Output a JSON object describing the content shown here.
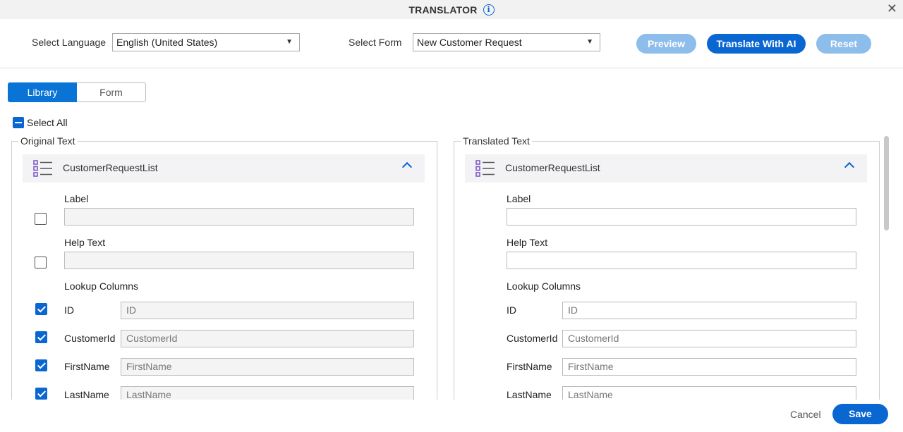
{
  "window": {
    "title": "TRANSLATOR"
  },
  "toolbar": {
    "language_label": "Select Language",
    "language_value": "English (United States)",
    "form_label": "Select Form",
    "form_value": "New Customer Request",
    "preview_label": "Preview",
    "translate_label": "Translate With AI",
    "reset_label": "Reset"
  },
  "tabs": [
    {
      "label": "Library",
      "active": true
    },
    {
      "label": "Form",
      "active": false
    }
  ],
  "select_all_label": "Select All",
  "original": {
    "legend": "Original Text",
    "section_title": "CustomerRequestList",
    "label_caption": "Label",
    "label_value": "",
    "label_checked": false,
    "help_caption": "Help Text",
    "help_value": "",
    "help_checked": false,
    "lookup_caption": "Lookup Columns",
    "columns": [
      {
        "name": "ID",
        "value": "ID",
        "checked": true
      },
      {
        "name": "CustomerId",
        "value": "CustomerId",
        "checked": true
      },
      {
        "name": "FirstName",
        "value": "FirstName",
        "checked": true
      },
      {
        "name": "LastName",
        "value": "LastName",
        "checked": true
      }
    ]
  },
  "translated": {
    "legend": "Translated Text",
    "section_title": "CustomerRequestList",
    "label_caption": "Label",
    "label_value": "",
    "help_caption": "Help Text",
    "help_value": "",
    "lookup_caption": "Lookup Columns",
    "columns": [
      {
        "name": "ID",
        "value": "ID"
      },
      {
        "name": "CustomerId",
        "value": "CustomerId"
      },
      {
        "name": "FirstName",
        "value": "FirstName"
      },
      {
        "name": "LastName",
        "value": "LastName"
      }
    ]
  },
  "footer": {
    "cancel_label": "Cancel",
    "save_label": "Save"
  },
  "colors": {
    "accent": "#0a66d1",
    "accent_light": "#8dbdeb",
    "section_icon": "#7a4fc4"
  }
}
